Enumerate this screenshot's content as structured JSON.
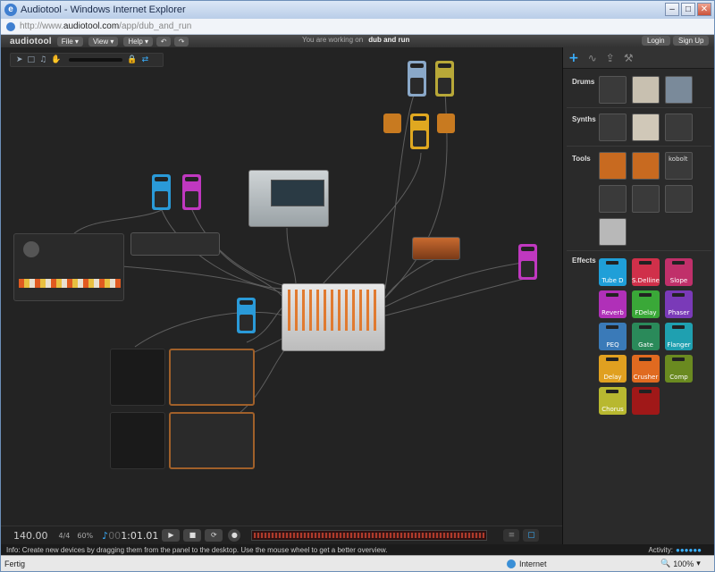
{
  "window": {
    "title": "Audiotool - Windows Internet Explorer"
  },
  "address": {
    "prefix": "http://www.",
    "domain": "audiotool.com",
    "path": "/app/dub_and_run"
  },
  "app": {
    "logo": "audiotool",
    "menus": [
      "File ▾",
      "View ▾",
      "Help ▾"
    ],
    "working_prefix": "You are working on",
    "project_name": "dub and run",
    "login": "Login",
    "signup": "Sign Up"
  },
  "panel": {
    "sections": {
      "drums": "Drums",
      "synths": "Synths",
      "tools": "Tools",
      "effects": "Effects"
    },
    "tool_label": "kobolt",
    "effects": [
      {
        "label": "Tube D",
        "color": "#1f9fd8"
      },
      {
        "label": "S.Delline",
        "color": "#d0304a"
      },
      {
        "label": "Slope",
        "color": "#c0306a"
      },
      {
        "label": "Reverb",
        "color": "#b030b8"
      },
      {
        "label": "FDelay",
        "color": "#3aa838"
      },
      {
        "label": "Phaser",
        "color": "#7a3ab8"
      },
      {
        "label": "PEQ",
        "color": "#3a7ab8"
      },
      {
        "label": "Gate",
        "color": "#2a8a5a"
      },
      {
        "label": "Flanger",
        "color": "#1fa0b0"
      },
      {
        "label": "Delay",
        "color": "#e0a020"
      },
      {
        "label": "Crusher",
        "color": "#e06a20"
      },
      {
        "label": "Comp",
        "color": "#6a8a20"
      },
      {
        "label": "Chorus",
        "color": "#b8b830"
      },
      {
        "label": "",
        "color": "#a01818"
      }
    ]
  },
  "transport": {
    "tempo": "140.00",
    "signature": "4/4",
    "zoom": "60%",
    "time_dim": "00",
    "time": "1:01.01"
  },
  "info": {
    "text": "Info: Create new devices by dragging them from the panel to the desktop. Use the mouse wheel to get a better overview.",
    "activity": "Activity:",
    "activity_dots": "●●●●●●"
  },
  "statusbar": {
    "left": "Fertig",
    "zone": "Internet",
    "zoom": "100%"
  },
  "colors": {
    "accent": "#3ab0ff",
    "desk": "#232323"
  }
}
